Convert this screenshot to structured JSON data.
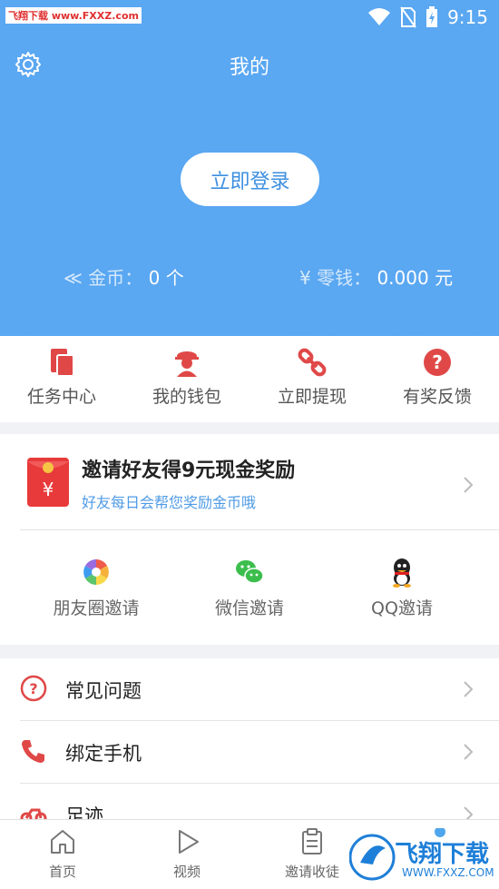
{
  "status_bar": {
    "watermark": "飞翔下载 www.FXXZ.com",
    "time": "9:15"
  },
  "header": {
    "title": "我的",
    "login_button": "立即登录",
    "coins_label": "金币：",
    "coins_value": "0 个",
    "cash_label": "零钱：",
    "cash_value": "0.000 元"
  },
  "actions": [
    {
      "label": "任务中心",
      "icon": "task-icon"
    },
    {
      "label": "我的钱包",
      "icon": "wallet-icon"
    },
    {
      "label": "立即提现",
      "icon": "link-icon"
    },
    {
      "label": "有奖反馈",
      "icon": "question-icon"
    }
  ],
  "invite": {
    "title": "邀请好友得9元现金奖励",
    "subtitle": "好友每日会帮您奖励金币哦",
    "share": [
      {
        "label": "朋友圈邀请",
        "icon": "moments-icon"
      },
      {
        "label": "微信邀请",
        "icon": "wechat-icon"
      },
      {
        "label": "QQ邀请",
        "icon": "qq-icon"
      }
    ]
  },
  "menu": [
    {
      "label": "常见问题",
      "icon": "faq-icon"
    },
    {
      "label": "绑定手机",
      "icon": "phone-icon"
    },
    {
      "label": "足迹",
      "icon": "motorbike-icon"
    }
  ],
  "tabs": [
    {
      "label": "首页",
      "icon": "home-icon"
    },
    {
      "label": "视频",
      "icon": "play-icon"
    },
    {
      "label": "邀请收徒",
      "icon": "clipboard-icon"
    }
  ],
  "watermark": {
    "big": "飞翔下载",
    "small": "WWW.FXXZ.COM"
  },
  "colors": {
    "primary": "#5aa7f2",
    "accent_red": "#e04848"
  }
}
